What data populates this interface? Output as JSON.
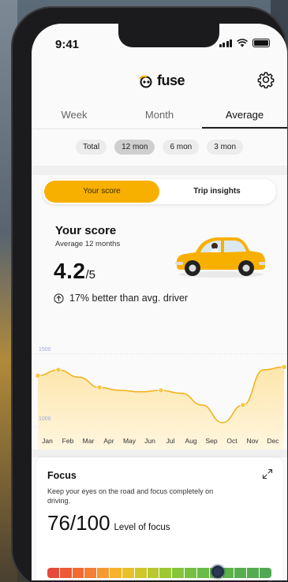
{
  "status_bar": {
    "time": "9:41"
  },
  "app": {
    "name": "fuse"
  },
  "period_tabs": [
    {
      "label": "Week",
      "active": false
    },
    {
      "label": "Month",
      "active": false
    },
    {
      "label": "Average",
      "active": true
    }
  ],
  "range_chips": [
    {
      "label": "Total",
      "active": false
    },
    {
      "label": "12 mon",
      "active": true
    },
    {
      "label": "6 mon",
      "active": false
    },
    {
      "label": "3 mon",
      "active": false
    }
  ],
  "segment": {
    "score_label": "Your score",
    "insights_label": "Trip insights",
    "active": "Your score"
  },
  "score": {
    "title": "Your score",
    "subtitle": "Average 12 months",
    "value": "4.2",
    "out_of": "/5",
    "comparison": "17% better than avg. driver"
  },
  "chart_data": {
    "type": "area",
    "categories": [
      "Jan",
      "Feb",
      "Mar",
      "Apr",
      "May",
      "Jun",
      "Jul",
      "Aug",
      "Sep",
      "Oct",
      "Nov",
      "Dec"
    ],
    "ytick_labels": [
      "1500",
      "1000"
    ],
    "ylim": [
      900,
      1600
    ],
    "series": [
      {
        "values": [
          1350,
          1390,
          1340,
          1270,
          1250,
          1240,
          1250,
          1230,
          1150,
          1030,
          1150,
          1390
        ]
      }
    ],
    "marked_indices": [
      0,
      1,
      3,
      6,
      10,
      12
    ],
    "colors": {
      "line": "#f2b320",
      "fill_top": "#fde6ab",
      "fill_bottom": "#fff6e0"
    }
  },
  "focus": {
    "title": "Focus",
    "description": "Keep your eyes on the road and focus completely on driving.",
    "value": "76/100",
    "value_label": "Level of focus",
    "gauge_value": 76,
    "gauge_min": "0",
    "gauge_max": "100"
  },
  "icons": {
    "settings": "gear-icon",
    "up": "arrow-up-circle-icon",
    "expand": "expand-icon",
    "logo": "fuse-logo-icon",
    "car": "car-illustration"
  },
  "colors": {
    "accent": "#f8b000",
    "background": "#fafafa"
  }
}
